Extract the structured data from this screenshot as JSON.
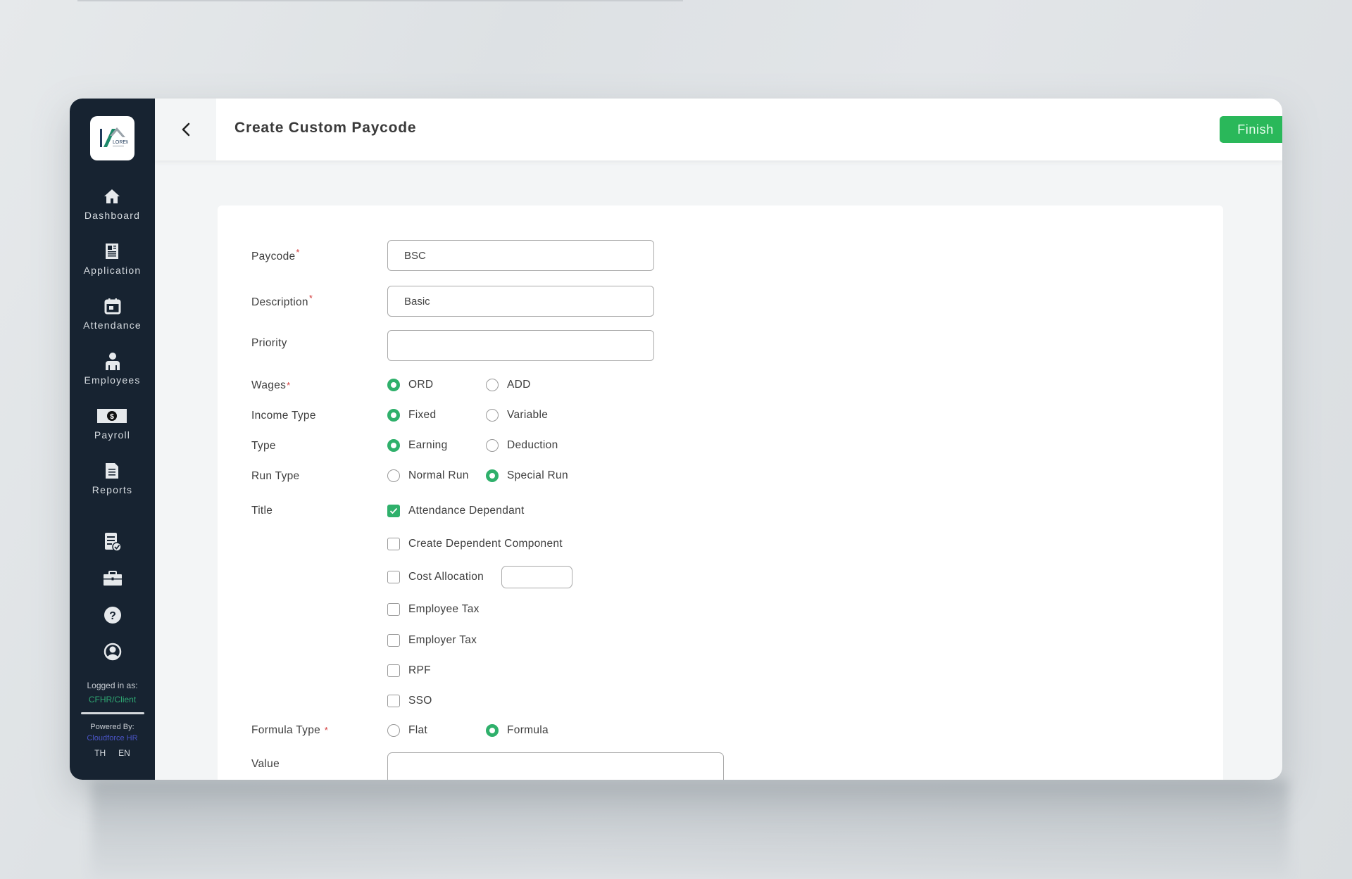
{
  "app": {
    "logo_text": "LOREM",
    "page_title": "Create Custom Paycode",
    "finish_label": "Finish",
    "accent_color": "#2ab85a"
  },
  "sidebar": {
    "items": [
      {
        "label": "Dashboard",
        "icon": "home-icon"
      },
      {
        "label": "Application",
        "icon": "document-icon"
      },
      {
        "label": "Attendance",
        "icon": "calendar-icon"
      },
      {
        "label": "Employees",
        "icon": "person-icon"
      },
      {
        "label": "Payroll",
        "icon": "dollar-bill-icon"
      },
      {
        "label": "Reports",
        "icon": "report-icon"
      }
    ],
    "tools": [
      {
        "icon": "approval-list-icon"
      },
      {
        "icon": "briefcase-icon"
      },
      {
        "icon": "help-icon"
      },
      {
        "icon": "user-circle-icon"
      }
    ],
    "logged_in_label": "Logged in as:",
    "logged_in_user": "CFHR/Client",
    "powered_by_label": "Powered By:",
    "powered_by_brand": "Cloudforce HR",
    "languages": [
      "TH",
      "EN"
    ]
  },
  "form": {
    "paycode": {
      "label": "Paycode",
      "value": "BSC",
      "required": "*"
    },
    "description": {
      "label": "Description",
      "value": "Basic",
      "required": "*"
    },
    "priority": {
      "label": "Priority",
      "value": ""
    },
    "wages": {
      "label": "Wages",
      "required": "*",
      "options": [
        "ORD",
        "ADD"
      ],
      "selected": "ORD"
    },
    "income_type": {
      "label": "Income Type",
      "options": [
        "Fixed",
        "Variable"
      ],
      "selected": "Fixed"
    },
    "type": {
      "label": "Type",
      "options": [
        "Earning",
        "Deduction"
      ],
      "selected": "Earning"
    },
    "run_type": {
      "label": "Run Type",
      "options": [
        "Normal Run",
        "Special Run"
      ],
      "selected": "Special Run"
    },
    "title": {
      "label": "Title",
      "checkboxes": [
        {
          "label": "Attendance Dependant",
          "checked": true
        },
        {
          "label": "Create Dependent Component",
          "checked": false
        },
        {
          "label": "Cost Allocation",
          "checked": false
        },
        {
          "label": "Employee Tax",
          "checked": false
        },
        {
          "label": "Employer Tax",
          "checked": false
        },
        {
          "label": "RPF",
          "checked": false
        },
        {
          "label": "SSO",
          "checked": false
        }
      ],
      "cost_allocation_value": ""
    },
    "formula_type": {
      "label": "Formula Type",
      "required": "*",
      "options": [
        "Flat",
        "Formula"
      ],
      "selected": "Formula"
    },
    "value": {
      "label": "Value",
      "value": ""
    }
  }
}
